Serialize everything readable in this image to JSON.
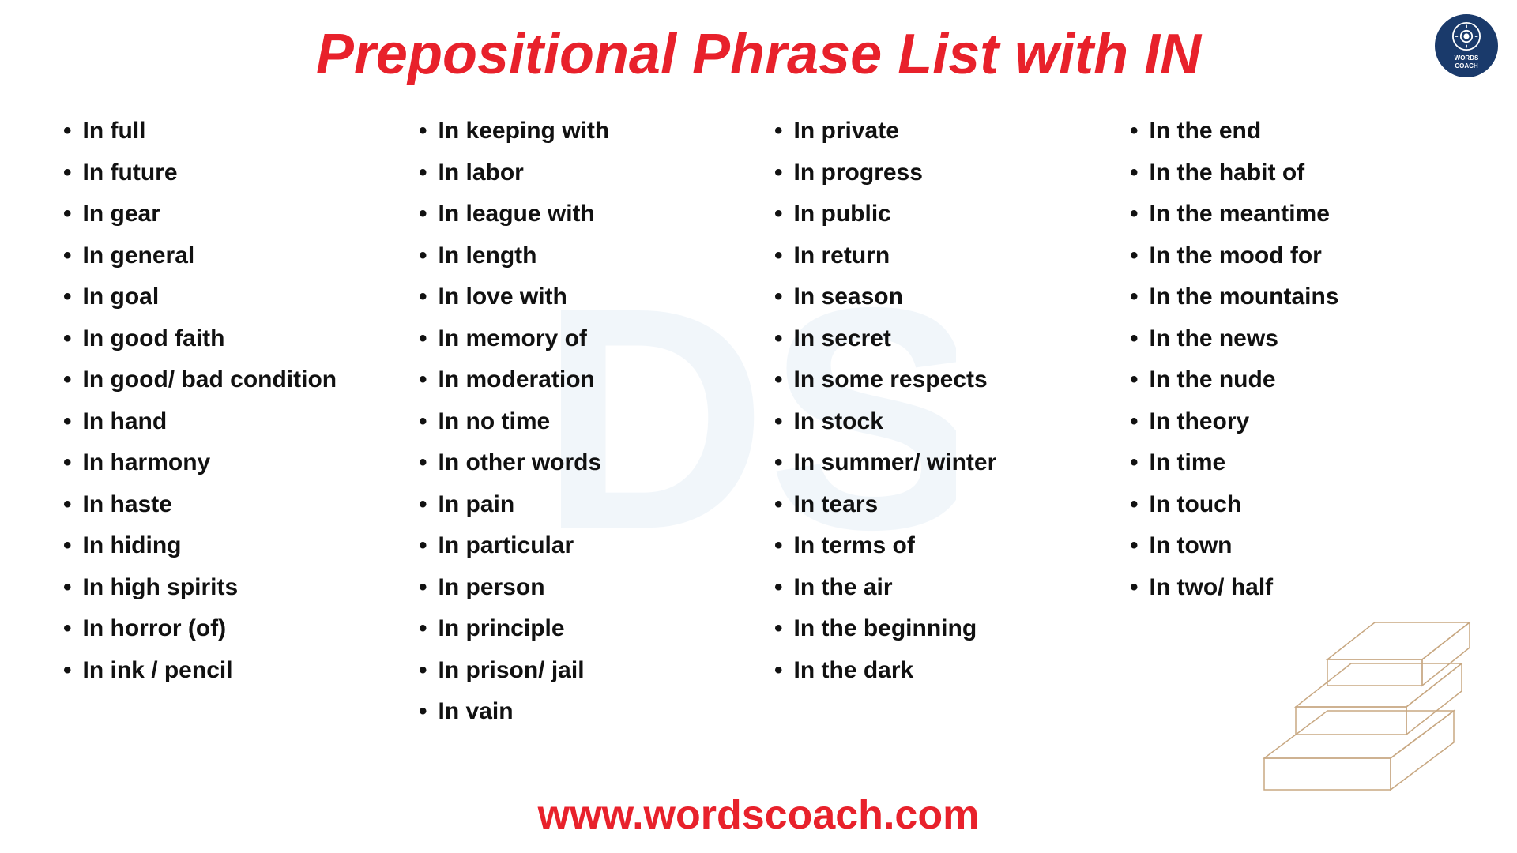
{
  "title": "Prepositional Phrase List with IN",
  "columns": [
    {
      "id": "col1",
      "items": [
        "In full",
        "In future",
        "In gear",
        "In general",
        "In goal",
        "In good faith",
        "In good/ bad condition",
        "In hand",
        "In harmony",
        "In haste",
        "In hiding",
        "In high spirits",
        "In horror (of)",
        "In ink / pencil"
      ]
    },
    {
      "id": "col2",
      "items": [
        "In keeping with",
        "In labor",
        "In league with",
        "In length",
        "In love with",
        "In memory of",
        "In moderation",
        "In no time",
        "In other words",
        "In pain",
        "In particular",
        "In person",
        "In principle",
        "In prison/ jail",
        "In vain"
      ]
    },
    {
      "id": "col3",
      "items": [
        "In private",
        "In progress",
        "In public",
        "In return",
        "In season",
        "In secret",
        "In some respects",
        "In stock",
        "In summer/ winter",
        "In tears",
        "In terms of",
        "In the air",
        "In the beginning",
        "In the dark"
      ]
    },
    {
      "id": "col4",
      "items": [
        "In the end",
        "In the habit of",
        "In the meantime",
        "In the mood for",
        "In the mountains",
        "In the news",
        "In the nude",
        "In theory",
        "In time",
        "In touch",
        "In town",
        "In two/ half"
      ]
    }
  ],
  "footer": "www.wordscoach.com",
  "logo": {
    "top_text": "WORDS",
    "bottom_text": "COACH"
  }
}
